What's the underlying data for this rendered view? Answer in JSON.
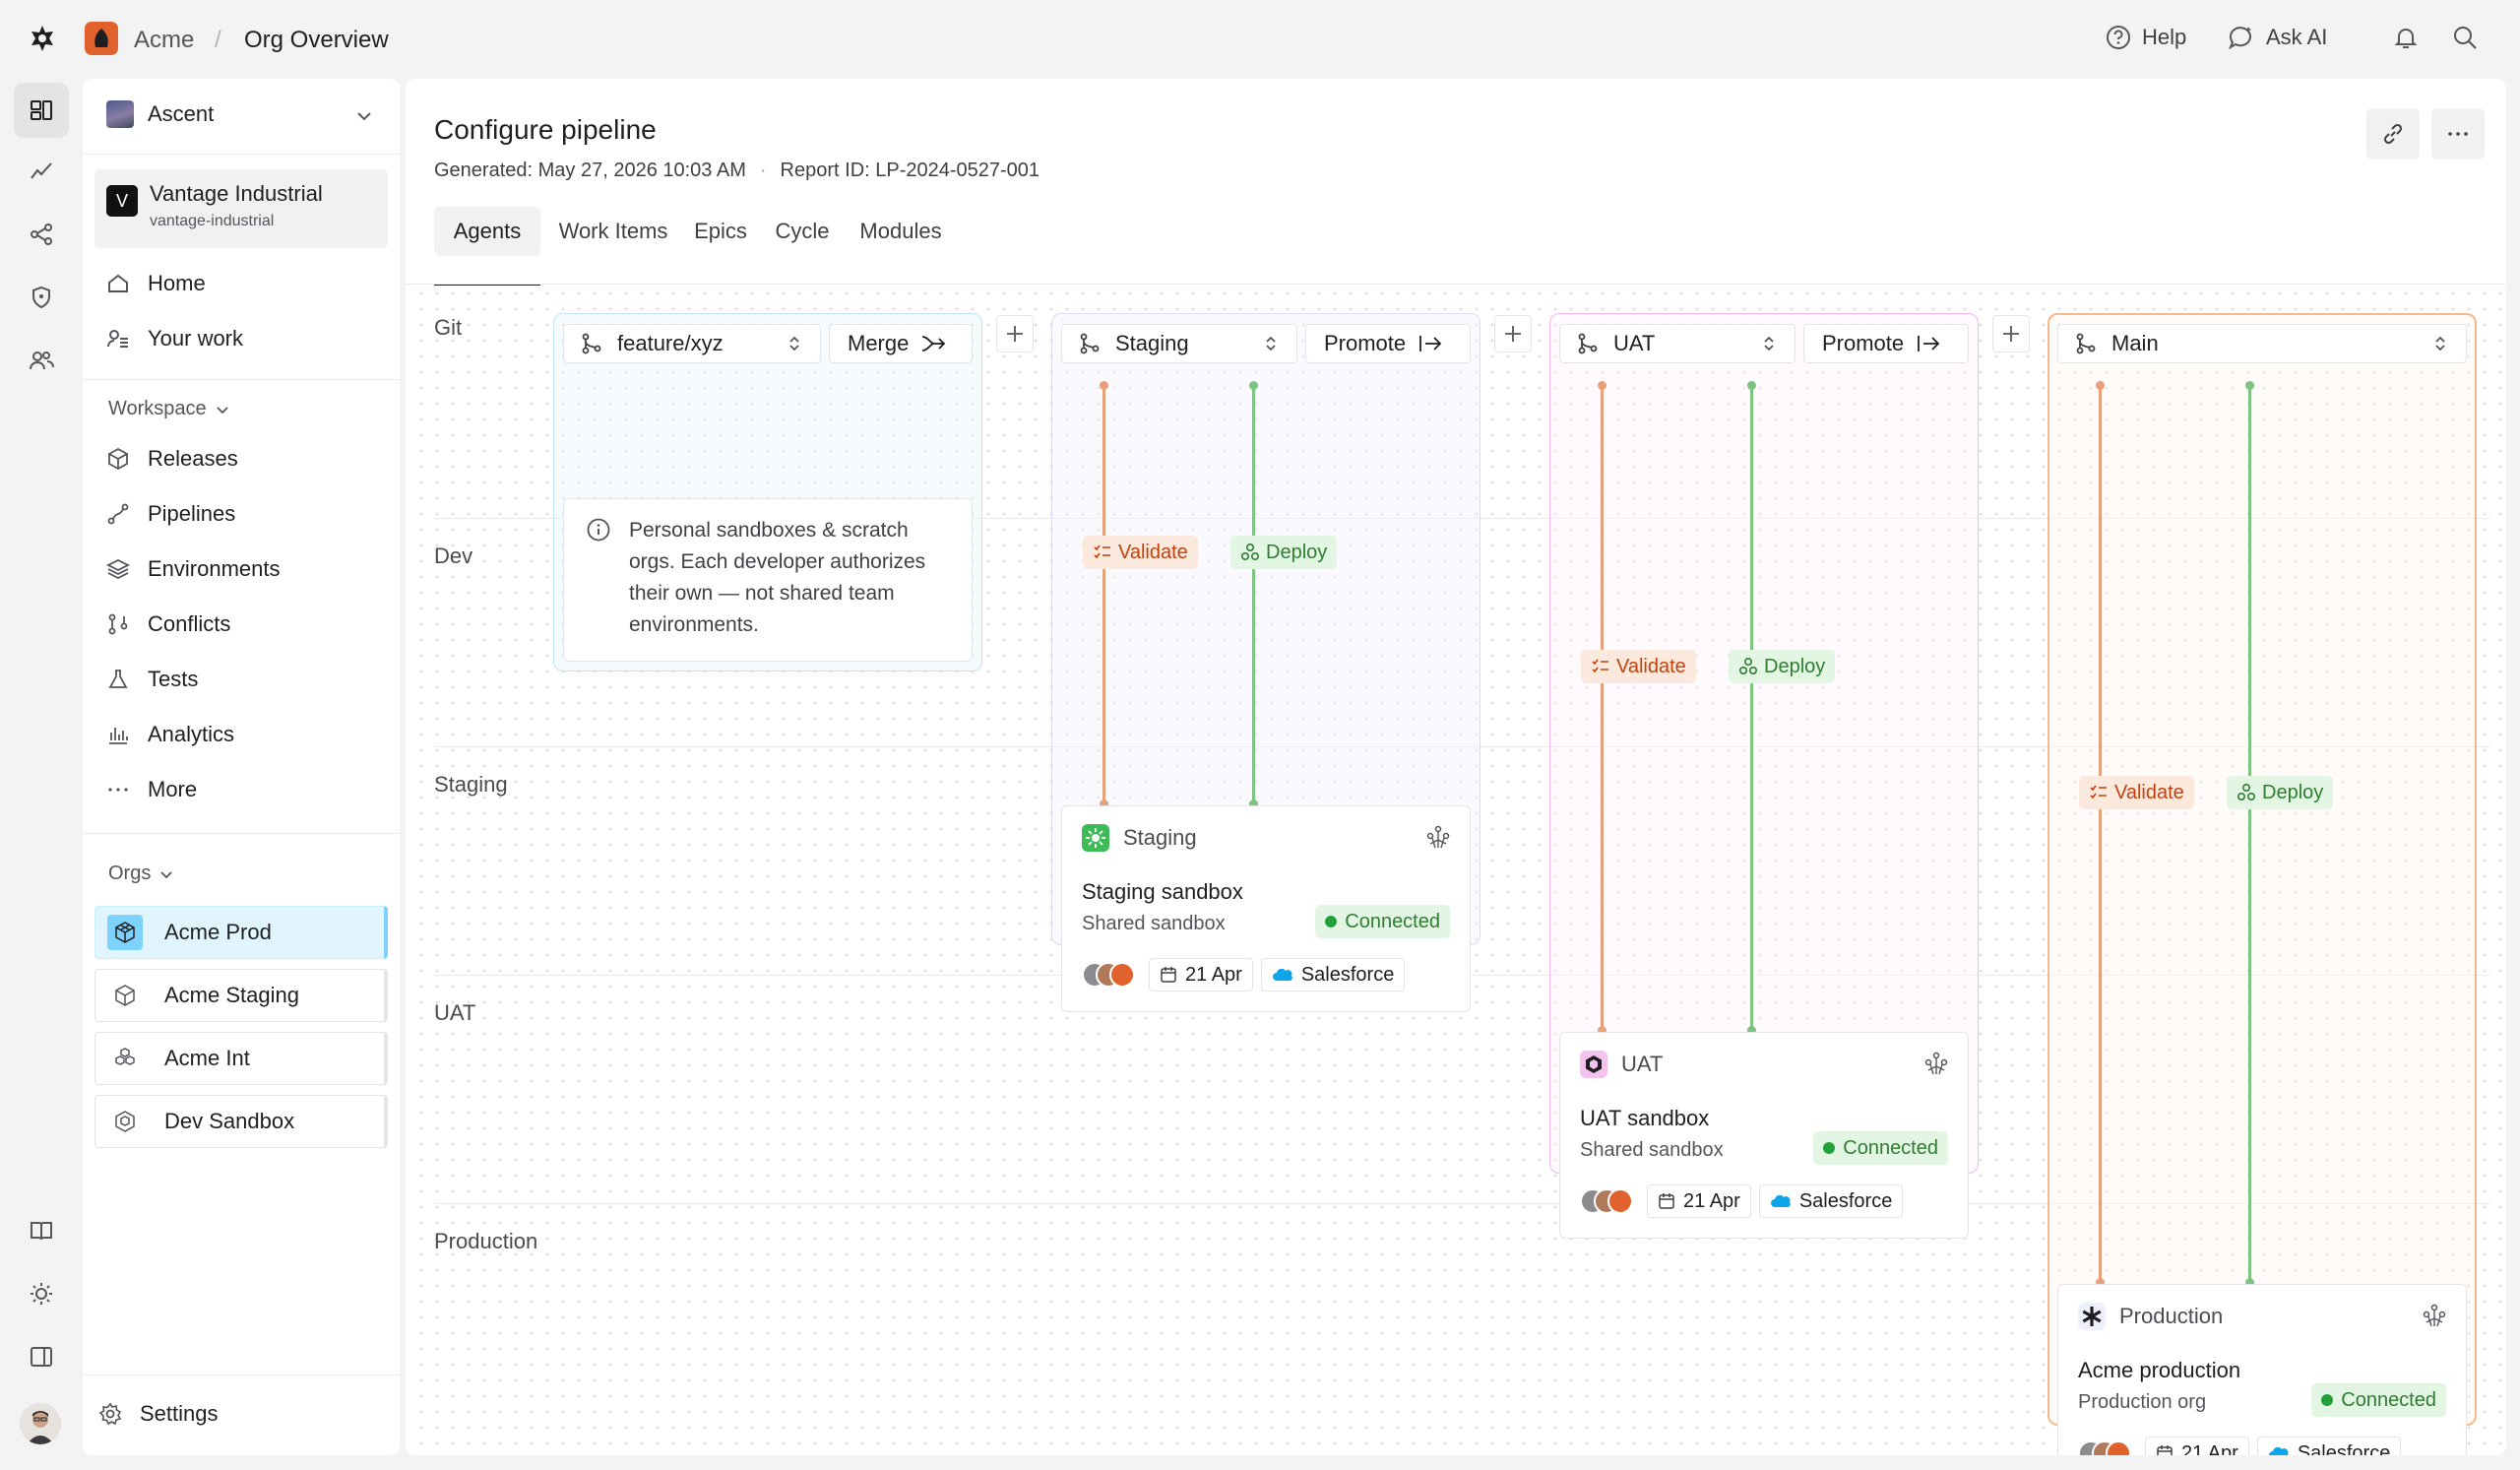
{
  "topbar": {
    "workspace": "Acme",
    "separator": "/",
    "page": "Org Overview",
    "help": "Help",
    "ask_ai": "Ask AI"
  },
  "sidebar": {
    "team": "Ascent",
    "account": {
      "initial": "V",
      "name": "Vantage Industrial",
      "slug": "vantage-industrial"
    },
    "nav": [
      {
        "label": "Home",
        "icon": "home-icon"
      },
      {
        "label": "Your work",
        "icon": "user-list-icon"
      }
    ],
    "workspace_label": "Workspace",
    "workspace_items": [
      {
        "label": "Releases",
        "icon": "package-icon"
      },
      {
        "label": "Pipelines",
        "icon": "pipeline-icon"
      },
      {
        "label": "Environments",
        "icon": "layers-icon"
      },
      {
        "label": "Conflicts",
        "icon": "branch-conflict-icon"
      },
      {
        "label": "Tests",
        "icon": "flask-icon"
      },
      {
        "label": "Analytics",
        "icon": "bar-chart-icon"
      },
      {
        "label": "More",
        "icon": "more-dots-icon"
      }
    ],
    "orgs_label": "Orgs",
    "orgs": [
      {
        "label": "Acme Prod",
        "selected": true
      },
      {
        "label": "Acme Staging",
        "selected": false
      },
      {
        "label": "Acme Int",
        "selected": false
      },
      {
        "label": "Dev Sandbox",
        "selected": false
      }
    ],
    "settings": "Settings"
  },
  "main": {
    "title": "Configure pipeline",
    "generated": "Generated: May 27, 2026 10:03 AM",
    "bullet": "·",
    "report_id": "Report ID: LP-2024-0527-001",
    "tabs": [
      "Agents",
      "Work Items",
      "Epics",
      "Cycle",
      "Modules"
    ],
    "active_tab": "Agents",
    "rows": [
      "Git",
      "Dev",
      "Staging",
      "UAT",
      "Production"
    ]
  },
  "pipeline": {
    "feature": {
      "branch": "feature/xyz",
      "action": "Merge",
      "note": "Personal sandboxes & scratch orgs. Each developer authorizes their own — not shared team environments."
    },
    "stages": [
      {
        "branch": "Staging",
        "action": "Promote",
        "validate": "Validate",
        "deploy": "Deploy",
        "card": {
          "env": "Staging",
          "name": "Staging sandbox",
          "type": "Shared sandbox",
          "status": "Connected",
          "date": "21 Apr",
          "platform": "Salesforce"
        }
      },
      {
        "branch": "UAT",
        "action": "Promote",
        "validate": "Validate",
        "deploy": "Deploy",
        "card": {
          "env": "UAT",
          "name": "UAT sandbox",
          "type": "Shared sandbox",
          "status": "Connected",
          "date": "21 Apr",
          "platform": "Salesforce"
        }
      },
      {
        "branch": "Main",
        "validate": "Validate",
        "deploy": "Deploy",
        "card": {
          "env": "Production",
          "name": "Acme production",
          "type": "Production org",
          "status": "Connected",
          "date": "21 Apr",
          "platform": "Salesforce"
        }
      }
    ]
  },
  "colors": {
    "validate": "#e8a07a",
    "deploy": "#7cc47f",
    "feature_border": "#bfe3f5",
    "staging_border": "#d8dcf5",
    "uat_border": "#f3b4ef",
    "main_border": "#f5b98c"
  }
}
